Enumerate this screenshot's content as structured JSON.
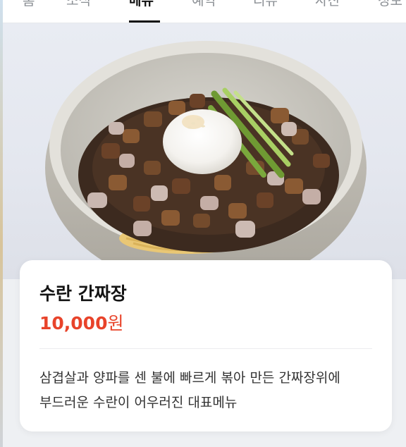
{
  "tabs": [
    {
      "label": "홈"
    },
    {
      "label": "소식"
    },
    {
      "label": "메뉴",
      "active": true
    },
    {
      "label": "예약"
    },
    {
      "label": "리뷰"
    },
    {
      "label": "사진"
    },
    {
      "label": "정보"
    }
  ],
  "menu_item": {
    "image_alt": "수란 간짜장 photo",
    "name": "수란 간짜장",
    "price_number": "10,000",
    "price_unit": "원",
    "description": "삼겹살과 양파를 센 불에 빠르게 볶아 만든 간짜장위에 부드러운 수란이 어우러진 대표메뉴"
  },
  "colors": {
    "price": "#e8432a",
    "active_tab": "#111111",
    "inactive_tab": "#8b8f94"
  }
}
